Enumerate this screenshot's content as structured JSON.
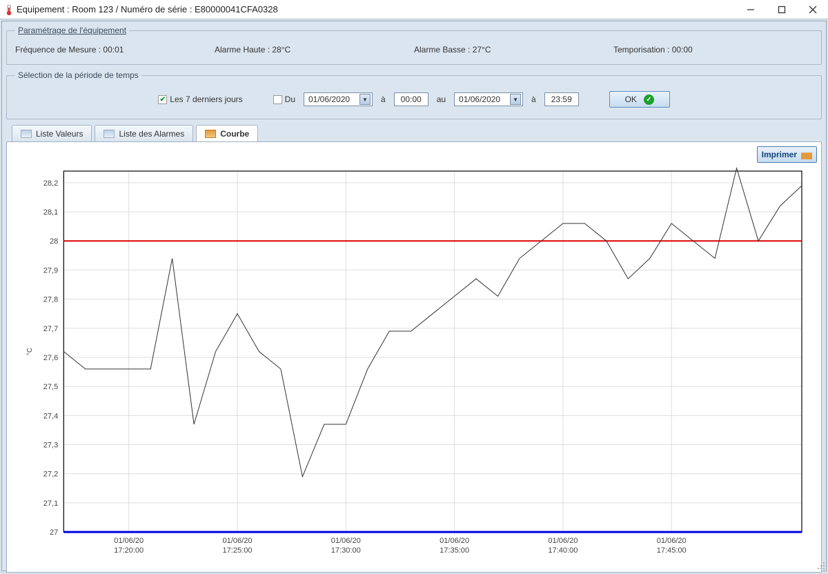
{
  "window": {
    "title": "Equipement : Room 123 / Numéro de série : E80000041CFA0328"
  },
  "groups": {
    "params_legend": "Paramétrage de l'équipement",
    "freq": "Fréquence de Mesure : 00:01",
    "alarm_hi": "Alarme Haute : 28°C",
    "alarm_lo": "Alarme Basse : 27°C",
    "tempo": "Temporisation : 00:00",
    "time_select_legend": "Sélection de la période de temps",
    "last7": "Les 7 derniers jours",
    "du": "Du",
    "a1": "à",
    "au": "au",
    "a2": "à",
    "date_from": "01/06/2020",
    "time_from": "00:00",
    "date_to": "01/06/2020",
    "time_to": "23:59",
    "ok": "OK"
  },
  "tabs": {
    "values": "Liste Valeurs",
    "alarms": "Liste des Alarmes",
    "curve": "Courbe"
  },
  "print": "Imprimer",
  "chart_data": {
    "type": "line",
    "ylabel": "°C",
    "ylim": [
      27.0,
      28.24
    ],
    "y_ticks": [
      27,
      27.1,
      27.2,
      27.3,
      27.4,
      27.5,
      27.6,
      27.7,
      27.8,
      27.9,
      28,
      28.1,
      28.2
    ],
    "x_tick_labels": [
      "01/06/20\n17:20:00",
      "01/06/20\n17:25:00",
      "01/06/20\n17:30:00",
      "01/06/20\n17:35:00",
      "01/06/20\n17:40:00",
      "01/06/20\n17:45:00"
    ],
    "x_tick_idx": [
      3,
      8,
      13,
      18,
      23,
      28
    ],
    "threshold_high": 28.0,
    "threshold_low": 27.0,
    "series": [
      {
        "name": "temperature",
        "values": [
          27.62,
          27.56,
          27.56,
          27.56,
          27.56,
          27.94,
          27.37,
          27.62,
          27.75,
          27.62,
          27.56,
          27.19,
          27.37,
          27.37,
          27.56,
          27.69,
          27.69,
          27.75,
          27.81,
          27.87,
          27.81,
          27.94,
          28.0,
          28.06,
          28.06,
          28.0,
          27.87,
          27.94,
          28.06,
          28.0,
          27.94,
          28.25,
          28.0,
          28.12,
          28.19
        ]
      }
    ]
  }
}
